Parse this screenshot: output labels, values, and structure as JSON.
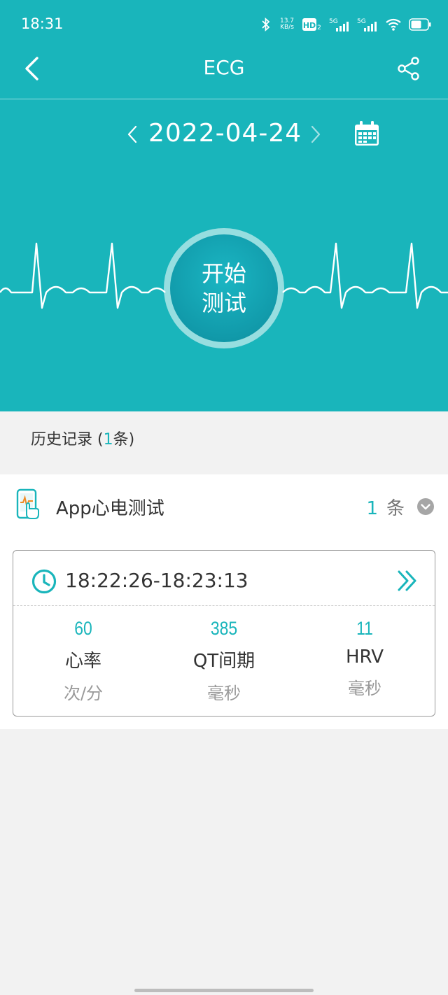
{
  "status_bar": {
    "time": "18:31",
    "net_speed_value": "13.7",
    "net_speed_unit": "KB/s",
    "hd_badge": "HD",
    "sim1_label": "5G",
    "sim2_label": "5G"
  },
  "nav": {
    "title": "ECG",
    "back_icon": "chevron-left-icon",
    "share_icon": "share-icon"
  },
  "date_selector": {
    "date": "2022-04-24",
    "prev_icon": "chevron-left-icon",
    "next_icon": "chevron-right-icon",
    "calendar_icon": "calendar-icon"
  },
  "start_button": {
    "line1": "开始",
    "line2": "测试"
  },
  "history": {
    "label": "历史记录",
    "open": "(",
    "count": "1",
    "suffix": "条)"
  },
  "group": {
    "title": "App心电测试",
    "count": "1",
    "unit": "条",
    "icon": "phone-ecg-icon",
    "toggle_icon": "chevron-down-circle-icon"
  },
  "record": {
    "time_range": "18:22:26-18:23:13",
    "metrics": [
      {
        "value": "60",
        "label": "心率",
        "unit": "次/分"
      },
      {
        "value": "385",
        "label": "QT间期",
        "unit": "毫秒"
      },
      {
        "value": "11",
        "label": "HRV",
        "unit": "毫秒"
      }
    ]
  },
  "colors": {
    "primary": "#19b5bb",
    "button": "#119aaa",
    "background": "#f2f2f2"
  }
}
